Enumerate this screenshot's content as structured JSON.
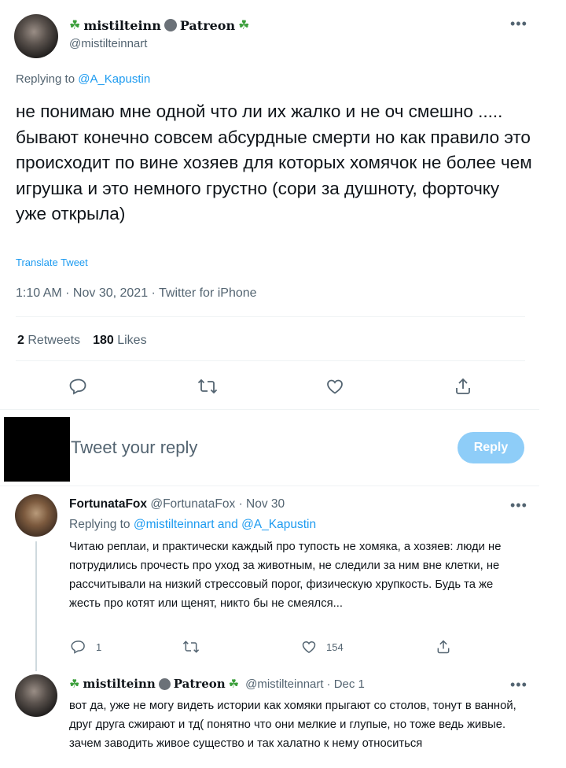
{
  "main_tweet": {
    "display_name": "mistilteinn",
    "name_suffix": "Patreon",
    "handle": "@mistilteinnart",
    "replying_label": "Replying to",
    "replying_to": "@A_Kapustin",
    "text": "не понимаю мне одной что ли их жалко и не оч смешно ..... бывают конечно совсем абсурдные смерти но как правило это происходит по вине хозяев для которых хомячок не более чем игрушка и это немного грустно (сори за душноту, форточку уже открыла)",
    "translate_label": "Translate Tweet",
    "timestamp": "1:10 AM · Nov 30, 2021 · Twitter for iPhone",
    "retweets_count": "2",
    "retweets_label": "Retweets",
    "likes_count": "180",
    "likes_label": "Likes"
  },
  "reply_box": {
    "placeholder": "Tweet your reply",
    "button_label": "Reply"
  },
  "reply1": {
    "display_name": "FortunataFox",
    "handle": "@FortunataFox",
    "date": "· Nov 30",
    "replying_label": "Replying to",
    "replying_to": "@mistilteinnart and @A_Kapustin",
    "text": "Читаю реплаи, и практически каждый про тупость не хомяка, а хозяев: люди не потрудились прочесть про уход за животным, не следили за ним вне клетки, не рассчитывали на низкий стрессовый порог, физическую хрупкость. Будь та же жесть про котят или щенят, никто бы не смеялся...",
    "reply_count": "1",
    "like_count": "154"
  },
  "reply2": {
    "display_name": "mistilteinn",
    "name_suffix": "Patreon",
    "handle": "@mistilteinnart",
    "date": "· Dec 1",
    "text": "вот да, уже не могу видеть истории как хомяки прыгают со столов, тонут в ванной, друг друга сжирают и тд( понятно что они мелкие и глупые, но тоже ведь живые. зачем заводить живое существо и так халатно к нему относиться"
  },
  "colors": {
    "accent": "#1d9bf0",
    "reply_button": "#8ecdf8",
    "muted": "#536471"
  }
}
